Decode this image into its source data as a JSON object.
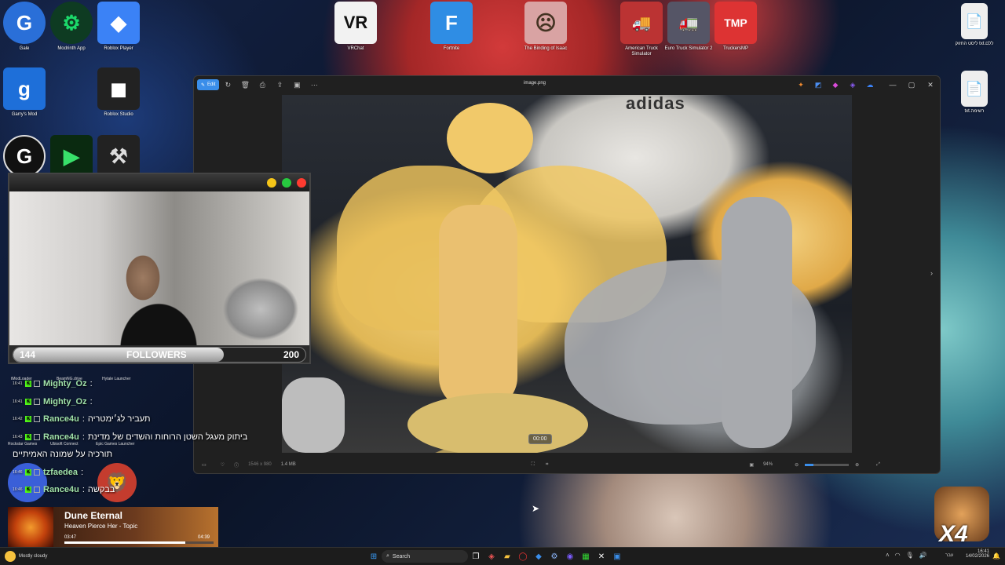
{
  "desktop_icons": [
    {
      "label": "Gale",
      "glyph": "G",
      "color": "#2a6fd8",
      "icon": "gale-icon"
    },
    {
      "label": "Modrinth App",
      "glyph": "⚙",
      "color": "#1bd96a",
      "icon": "modrinth-icon"
    },
    {
      "label": "Roblox Player",
      "glyph": "◆",
      "color": "#3b82f6",
      "icon": "roblox-player-icon"
    },
    {
      "label": "VRChat",
      "glyph": "VR",
      "color": "#f2f2f2",
      "icon": "vrchat-icon"
    },
    {
      "label": "Fortnite",
      "glyph": "F",
      "color": "#2f8de4",
      "icon": "fortnite-icon"
    },
    {
      "label": "The Binding of Isaac",
      "glyph": "☹",
      "color": "#d9a3a3",
      "icon": "isaac-icon"
    },
    {
      "label": "American Truck Simulator",
      "glyph": "🚚",
      "color": "#b33",
      "icon": "ats-icon"
    },
    {
      "label": "Euro Truck Simulator 2",
      "glyph": "🚛",
      "color": "#556",
      "icon": "ets2-icon"
    },
    {
      "label": "TruckersMP",
      "glyph": "TMP",
      "color": "#d33",
      "icon": "truckersmp-icon"
    },
    {
      "label": "Garry's Mod",
      "glyph": "g",
      "color": "#1e6fd9",
      "icon": "gmod-icon"
    },
    {
      "label": "Roblox Studio",
      "glyph": "◼",
      "color": "#222",
      "icon": "roblox-studio-icon"
    },
    {
      "label": "ליסט החזוק txt.ללם",
      "glyph": "📄",
      "color": "#eee",
      "icon": "text-file-icon"
    },
    {
      "label": "txt.רשימה",
      "glyph": "📄",
      "color": "#eee",
      "icon": "text-file-icon"
    }
  ],
  "behind_labels": [
    "tModLoader",
    "BeamNG.drive",
    "Hytale Launcher",
    "Rockstar Games",
    "Ubisoft Connect",
    "Epic Games Launcher"
  ],
  "viewer": {
    "edit_label": "Edit",
    "title": "image.png",
    "dimensions": "1546 x 980",
    "file_size": "1.4 MB",
    "zoom": "94%",
    "video_time": "00:00",
    "photo_brand": "adidas"
  },
  "webcam": {
    "followers_label": "FOLLOWERS",
    "current": "144",
    "goal": "200",
    "progress_fraction": 0.72
  },
  "chat": [
    {
      "time": "16:41",
      "name": "Mighty_Oz",
      "message": ""
    },
    {
      "time": "16:41",
      "name": "Mighty_Oz",
      "message": ""
    },
    {
      "time": "16:42",
      "name": "Rance4u",
      "message": "תעביר לג׳ימטריה"
    },
    {
      "time": "16:43",
      "name": "Rance4u",
      "message": "ביתוק מעגל השטן הרוחות והשדים של מדינת"
    },
    {
      "time": "",
      "name": "",
      "message": "תורכיה על שמונה האמיתיים"
    },
    {
      "time": "16:46",
      "name": "tzfaedea",
      "message": ""
    },
    {
      "time": "16:46",
      "name": "Rance4u",
      "message": "בבקשה"
    }
  ],
  "music": {
    "title": "Dune Eternal",
    "artist": "Heaven Pierce Her - Topic",
    "elapsed": "03:47",
    "total": "04:39",
    "progress_fraction": 0.81
  },
  "weather": "Mostly cloudy",
  "taskbar": {
    "search_placeholder": "Search",
    "clock_time": "16:41",
    "clock_date": "14/02/2026",
    "lang": "עבר"
  },
  "overlay_brand": "X4"
}
